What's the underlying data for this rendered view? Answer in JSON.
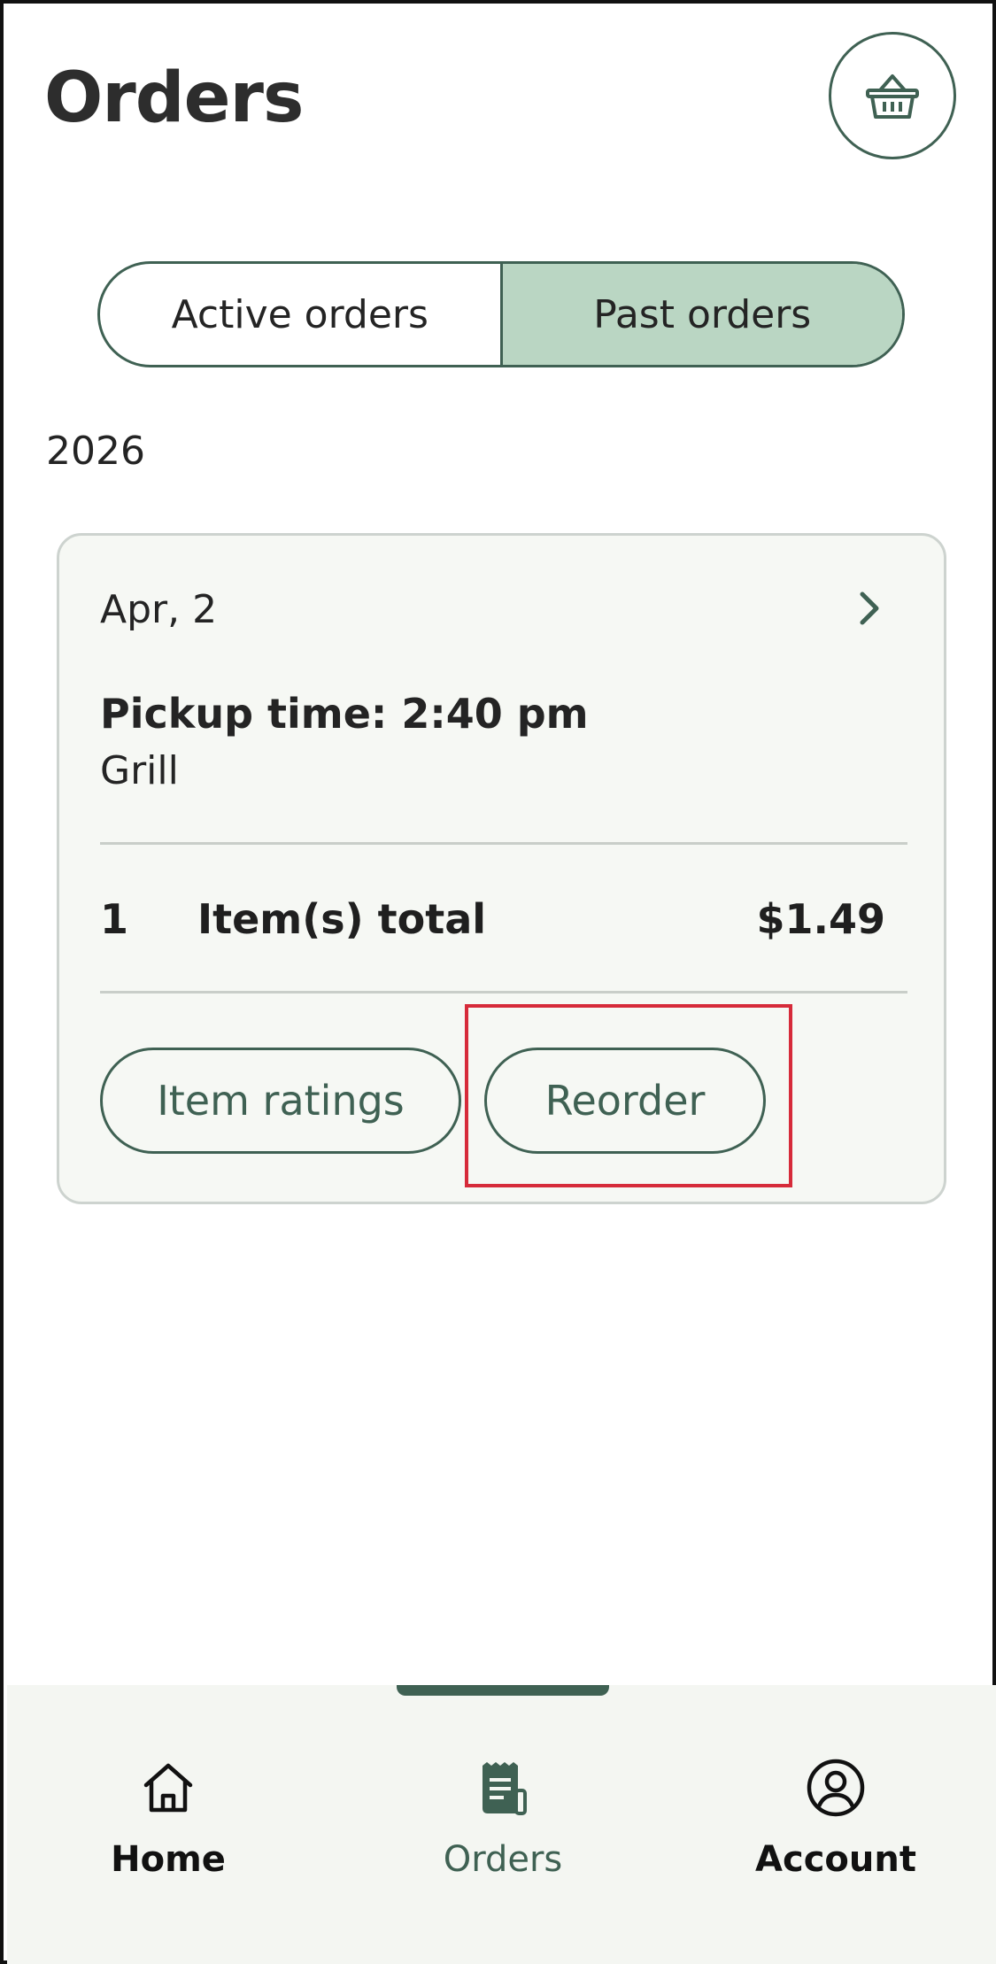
{
  "header": {
    "title": "Orders",
    "basket_icon": "basket-icon"
  },
  "tabs": [
    {
      "label": "Active orders",
      "active": false
    },
    {
      "label": "Past orders",
      "active": true
    }
  ],
  "year": "2026",
  "order": {
    "date": "Apr, 2",
    "pickup": "Pickup time: 2:40 pm",
    "location": "Grill",
    "items_count": "1",
    "items_label": "Item(s) total",
    "total": "$1.49",
    "ratings_label": "Item ratings",
    "reorder_label": "Reorder"
  },
  "nav": {
    "home": "Home",
    "orders": "Orders",
    "account": "Account",
    "active": "orders"
  },
  "colors": {
    "accent": "#3f6153",
    "active_tab_bg": "#bad6c3",
    "card_bg": "#f6f8f4",
    "highlight": "#d62b3a"
  }
}
